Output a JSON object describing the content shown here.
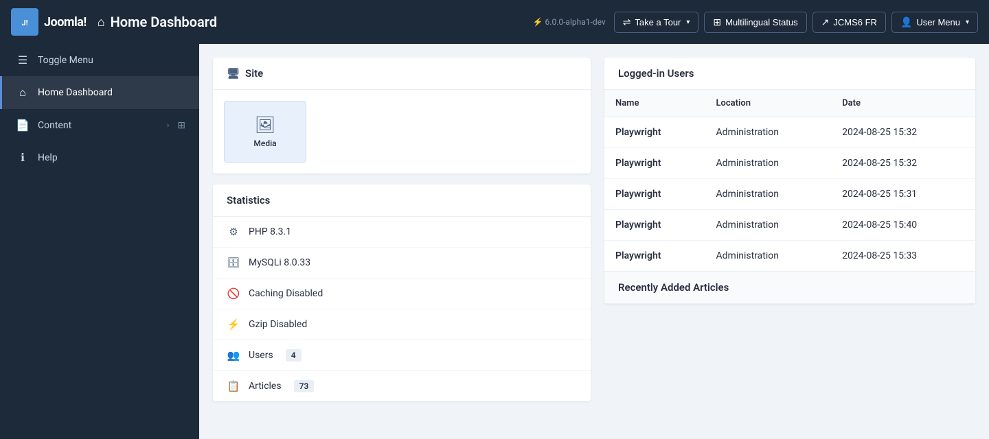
{
  "header": {
    "logo_text": "Joomla!",
    "page_title": "Home Dashboard",
    "version": "Joomla! 6.0.0-alpha1-dev",
    "version_short": "⚡ 6.0.0-alpha1-dev",
    "buttons": {
      "take_tour": "Take a Tour",
      "multilingual_status": "Multilingual Status",
      "jcms6_fr": "JCMS6 FR",
      "user_menu": "User Menu"
    }
  },
  "sidebar": {
    "items": [
      {
        "id": "toggle-menu",
        "label": "Toggle Menu",
        "icon": "☰"
      },
      {
        "id": "home-dashboard",
        "label": "Home Dashboard",
        "icon": "⌂",
        "active": true
      },
      {
        "id": "content",
        "label": "Content",
        "icon": "📄",
        "has_chevron": true,
        "has_grid": true
      },
      {
        "id": "help",
        "label": "Help",
        "icon": "ℹ"
      }
    ]
  },
  "site_panel": {
    "title": "Site",
    "media_items": [
      {
        "label": "Media",
        "icon": "🖼"
      }
    ]
  },
  "statistics_panel": {
    "title": "Statistics",
    "stats": [
      {
        "label": "PHP 8.3.1",
        "icon": "⚙"
      },
      {
        "label": "MySQLi 8.0.33",
        "icon": "🗄"
      },
      {
        "label": "Caching Disabled",
        "icon": "🚫"
      },
      {
        "label": "Gzip Disabled",
        "icon": "⚡"
      },
      {
        "label": "Users",
        "icon": "👥",
        "badge": "4"
      },
      {
        "label": "Articles",
        "icon": "📋",
        "badge": "73"
      }
    ]
  },
  "logged_in_users": {
    "title": "Logged-in Users",
    "columns": [
      "Name",
      "Location",
      "Date"
    ],
    "rows": [
      {
        "name": "Playwright",
        "location": "Administration",
        "date": "2024-08-25 15:32"
      },
      {
        "name": "Playwright",
        "location": "Administration",
        "date": "2024-08-25 15:32"
      },
      {
        "name": "Playwright",
        "location": "Administration",
        "date": "2024-08-25 15:31"
      },
      {
        "name": "Playwright",
        "location": "Administration",
        "date": "2024-08-25 15:40"
      },
      {
        "name": "Playwright",
        "location": "Administration",
        "date": "2024-08-25 15:33"
      }
    ]
  },
  "recently_added": {
    "title": "Recently Added Articles"
  },
  "colors": {
    "sidebar_bg": "#1d2a3a",
    "header_bg": "#1d2a3a",
    "active_border": "#5b8dd9"
  }
}
